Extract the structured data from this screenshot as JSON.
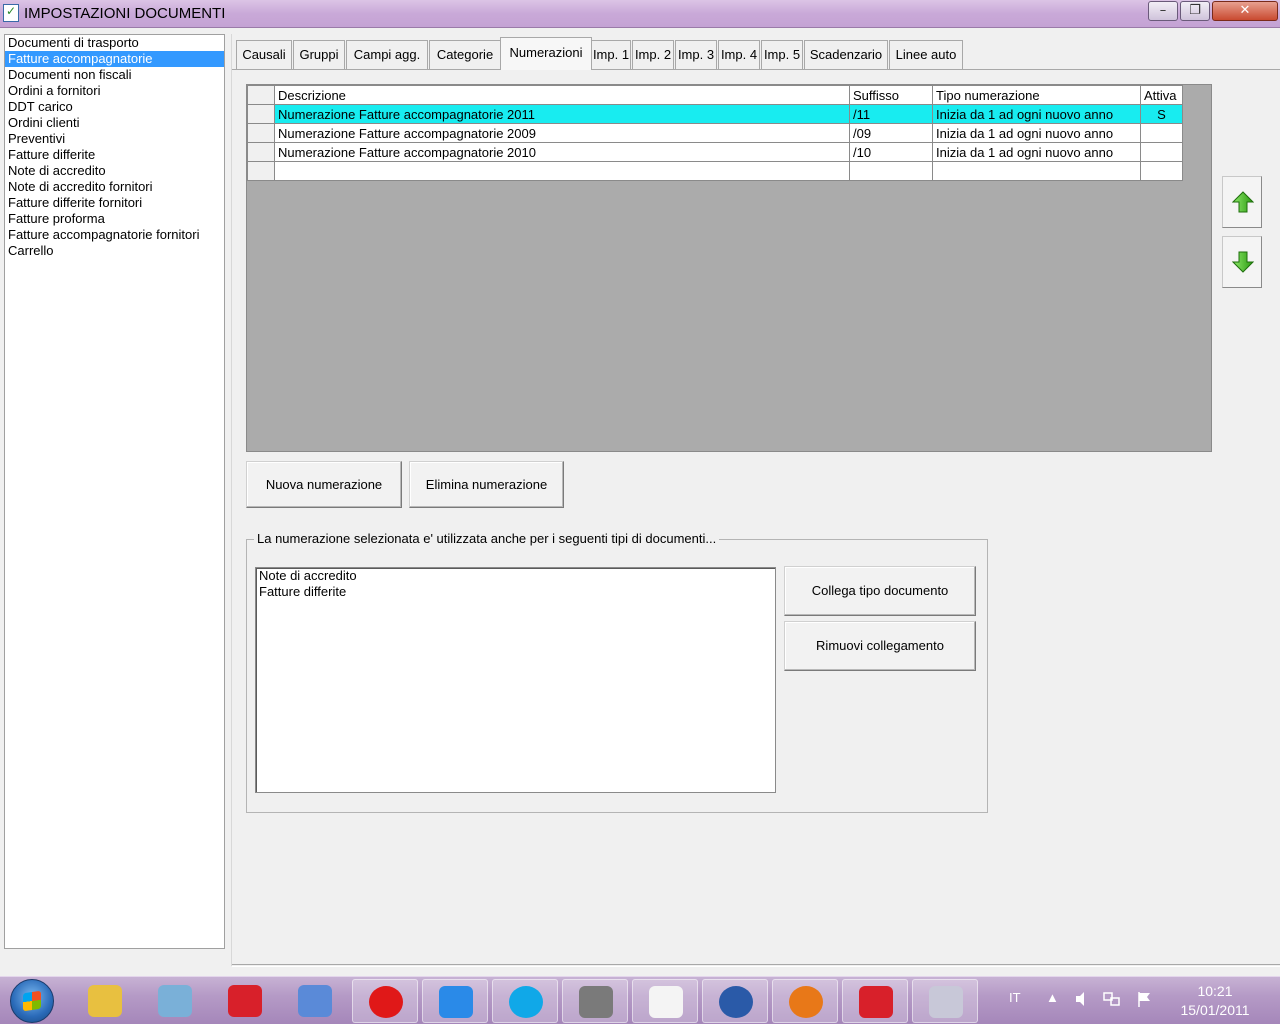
{
  "window": {
    "title": "IMPOSTAZIONI DOCUMENTI",
    "minimize": "–",
    "maximize": "❐",
    "close": "✕"
  },
  "doc_types": [
    "Documenti di trasporto",
    "Fatture accompagnatorie",
    "Documenti non fiscali",
    "Ordini a fornitori",
    "DDT carico",
    "Ordini clienti",
    "Preventivi",
    "Fatture differite",
    "Note di accredito",
    "Note di accredito fornitori",
    "Fatture differite fornitori",
    "Fatture proforma",
    "Fatture accompagnatorie fornitori",
    "Carrello"
  ],
  "doc_types_selected_index": 1,
  "tabs": [
    "Causali",
    "Gruppi",
    "Campi agg.",
    "Categorie",
    "Numerazioni",
    "Imp. 1",
    "Imp. 2",
    "Imp. 3",
    "Imp. 4",
    "Imp. 5",
    "Scadenzario",
    "Linee auto"
  ],
  "active_tab": "Numerazioni",
  "grid": {
    "columns": [
      "Descrizione",
      "Suffisso",
      "Tipo numerazione",
      "Attiva"
    ],
    "rows": [
      {
        "descrizione": "Numerazione Fatture accompagnatorie 2011",
        "suffisso": "/11",
        "tipo": "Inizia da 1 ad ogni nuovo anno",
        "attiva": "S"
      },
      {
        "descrizione": "Numerazione Fatture accompagnatorie 2009",
        "suffisso": "/09",
        "tipo": "Inizia da 1 ad ogni nuovo anno",
        "attiva": ""
      },
      {
        "descrizione": "Numerazione Fatture accompagnatorie 2010",
        "suffisso": "/10",
        "tipo": "Inizia da 1 ad ogni nuovo anno",
        "attiva": ""
      }
    ],
    "selected_row": 0
  },
  "buttons": {
    "new_numbering": "Nuova numerazione",
    "delete_numbering": "Elimina numerazione",
    "link_doc_type": "Collega tipo documento",
    "remove_link": "Rimuovi collegamento"
  },
  "linked_group": {
    "label": "La numerazione selezionata e' utilizzata anche per i seguenti tipi di documenti...",
    "items": [
      "Note di accredito",
      "Fatture differite"
    ]
  },
  "taskbar": {
    "language": "IT",
    "time": "10:21",
    "date": "15/01/2011",
    "items": [
      "explorer-icon",
      "mail-icon",
      "strawberry-icon",
      "scanner-icon",
      "opera-icon",
      "media-player-icon",
      "skype-icon",
      "printer-icon",
      "pdf-icon",
      "thunderbird-icon",
      "firefox-icon",
      "strawberry-icon",
      "installer-icon"
    ]
  },
  "colors": {
    "selected_row": "#18ecf0",
    "list_selection": "#3399ff",
    "grid_background": "#ababab",
    "arrow_green": "#3cb818"
  }
}
